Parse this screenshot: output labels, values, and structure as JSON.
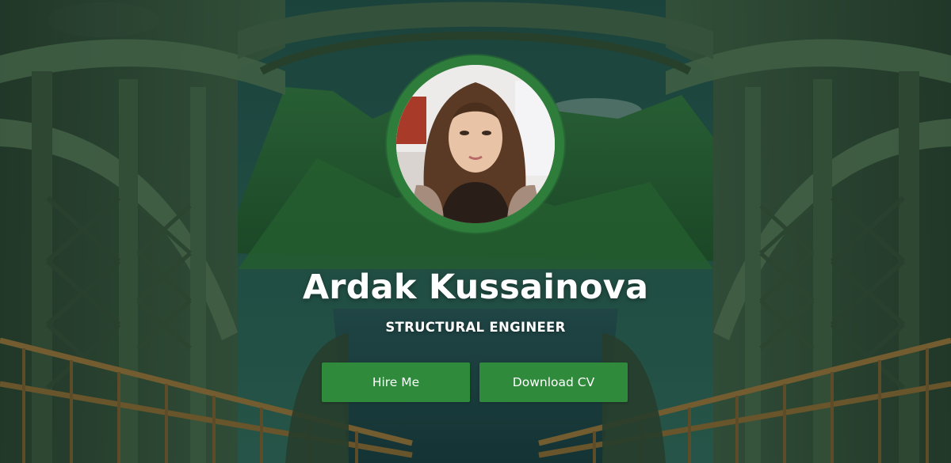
{
  "hero": {
    "name": "Ardak Kussainova",
    "role": "STRUCTURAL ENGINEER",
    "buttons": {
      "hire": "Hire Me",
      "cv": "Download CV"
    }
  },
  "colors": {
    "accent_green": "#2f8a3c",
    "ring_green": "#2e7d3a",
    "text": "#ffffff"
  }
}
